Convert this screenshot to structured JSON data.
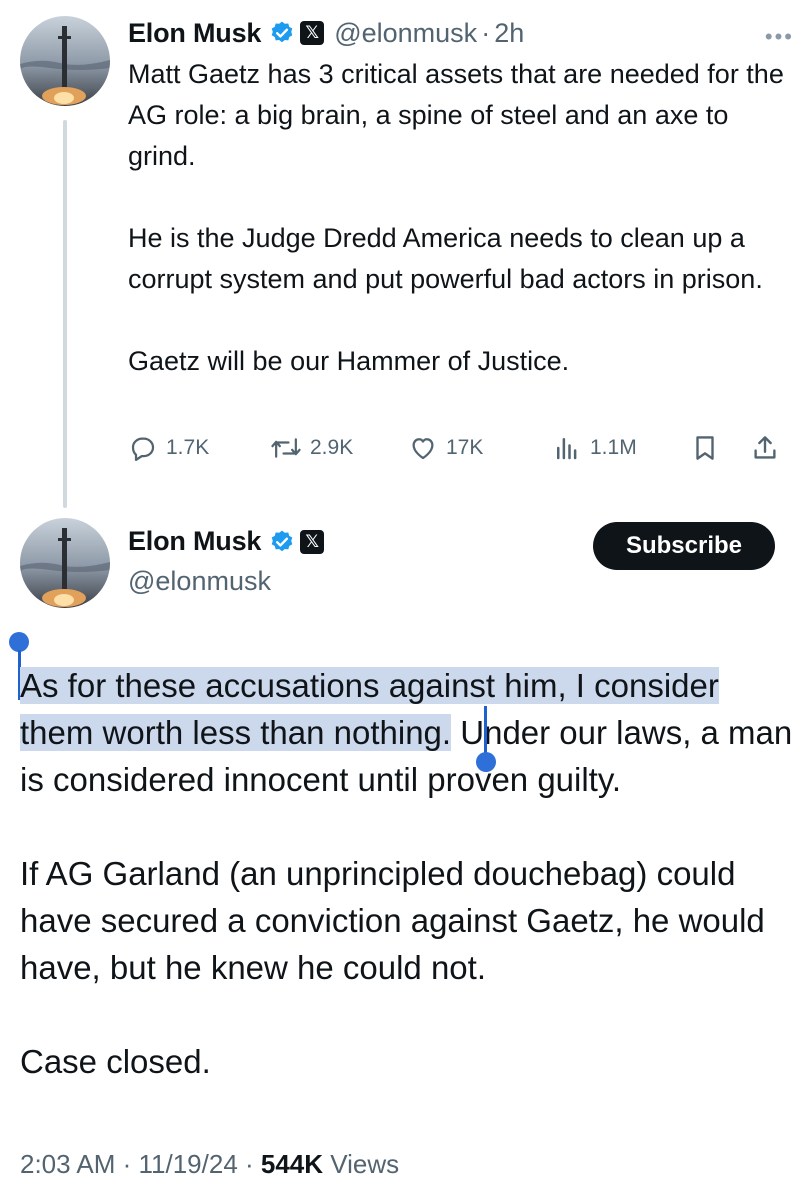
{
  "tweet1": {
    "name": "Elon Musk",
    "handle": "@elonmusk",
    "separator": "·",
    "time": "2h",
    "more": "•••",
    "paragraphs": [
      "Matt Gaetz has 3 critical assets that are needed for the AG role: a big brain, a spine of steel and an axe to grind.",
      "He is the Judge Dredd America needs to clean up a corrupt system and put powerful bad actors in prison.",
      "Gaetz will be our Hammer of Justice."
    ],
    "stats": {
      "replies": "1.7K",
      "reposts": "2.9K",
      "likes": "17K",
      "views": "1.1M"
    },
    "icons": [
      "reply-icon",
      "repost-icon",
      "like-icon",
      "views-icon",
      "bookmark-icon",
      "share-icon"
    ]
  },
  "tweet2": {
    "name": "Elon Musk",
    "handle": "@elonmusk",
    "subscribe_label": "Subscribe",
    "selected_text": "As for these accusations against him, I consider them worth less than nothing.",
    "after_selection": " Under our laws, a man is considered innocent until proven guilty.",
    "paragraphs": [
      "If AG Garland (an unprincipled douchebag) could have secured a conviction against Gaetz, he would have, but he knew he could not.",
      "Case closed."
    ],
    "timestamp": "2:03 AM · 11/19/24 · ",
    "views_count": "544K",
    "views_label": " Views"
  },
  "colors": {
    "verified": "#1d9bf0",
    "selection": "#ccd8ec",
    "handle": "#1f62cf",
    "muted": "#536471"
  }
}
